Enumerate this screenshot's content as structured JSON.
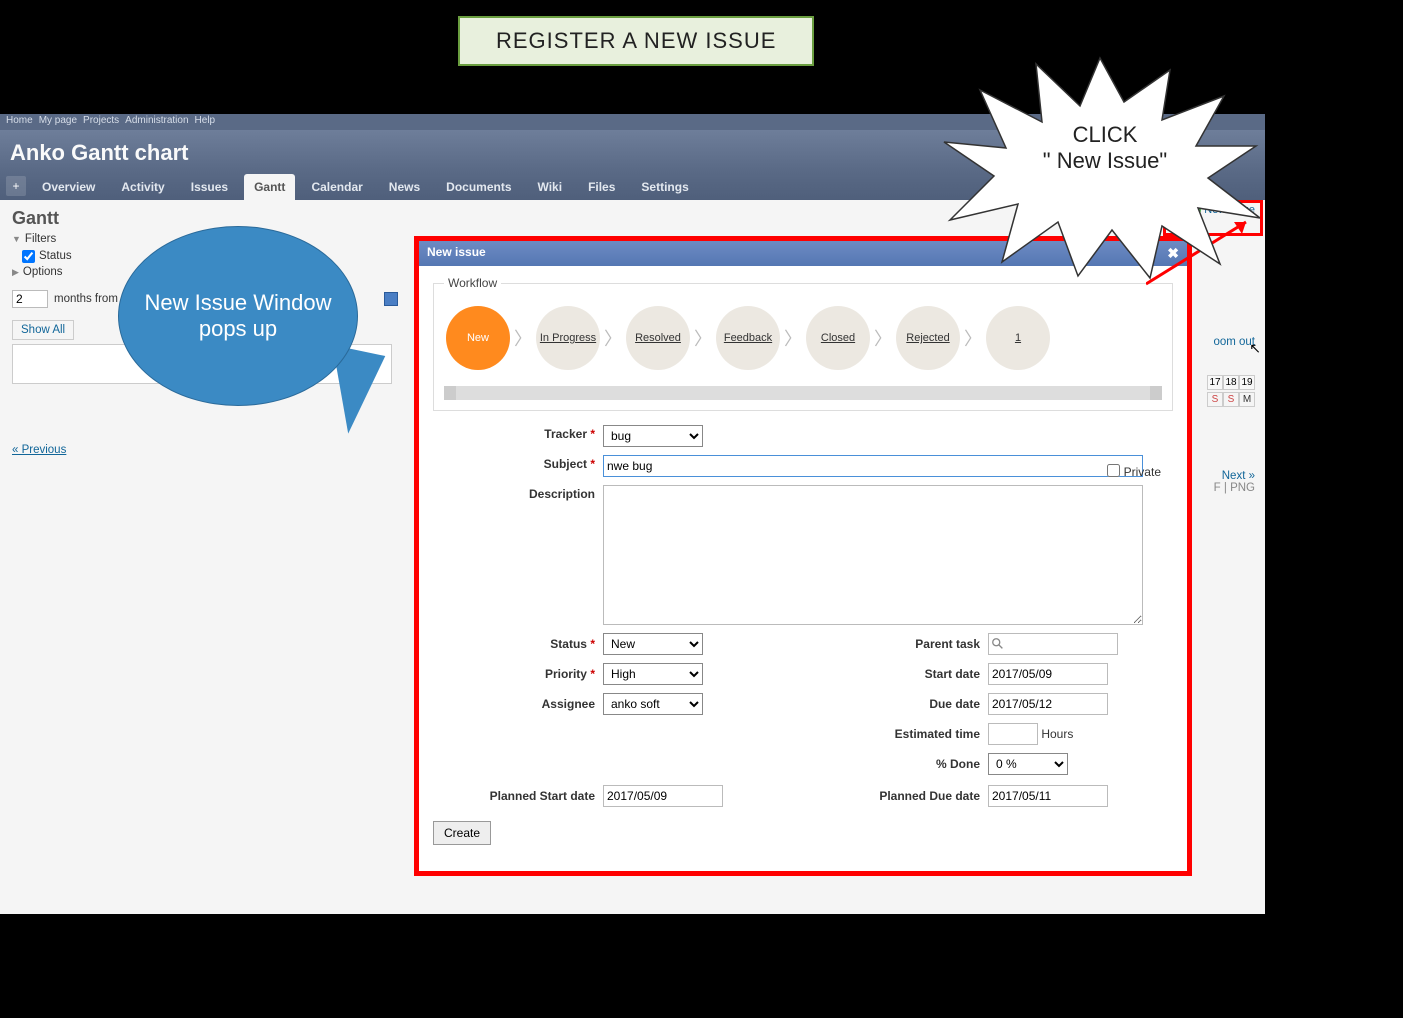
{
  "banner": "REGISTER A NEW ISSUE",
  "topnav": [
    "Home",
    "My page",
    "Projects",
    "Administration",
    "Help"
  ],
  "projectTitle": "Anko Gantt chart",
  "tabs": {
    "plus": "+",
    "items": [
      "Overview",
      "Activity",
      "Issues",
      "Gantt",
      "Calendar",
      "News",
      "Documents",
      "Wiki",
      "Files",
      "Settings"
    ],
    "activeIndex": 3
  },
  "page": {
    "title": "Gantt",
    "newissue": "New issue",
    "filtersLabel": "Filters",
    "statusLabel": "Status",
    "optionsLabel": "Options",
    "monthsValue": "2",
    "monthsLabel1": "months from",
    "showAll": "Show All",
    "previous": "« Previous",
    "nextLabel": "Next »",
    "zoom": "oom out",
    "pdfpng": "F | PNG",
    "days": [
      "17",
      "18",
      "19"
    ],
    "dayLetters": [
      "S",
      "S",
      "M"
    ]
  },
  "dialog": {
    "title": "New issue",
    "workflowLegend": "Workflow",
    "steps": [
      "New",
      "In Progress",
      "Resolved",
      "Feedback",
      "Closed",
      "Rejected",
      "1"
    ],
    "labels": {
      "tracker": "Tracker",
      "subject": "Subject",
      "description": "Description",
      "private": "Private",
      "status": "Status",
      "priority": "Priority",
      "assignee": "Assignee",
      "parent": "Parent task",
      "startdate": "Start date",
      "duedate": "Due date",
      "esttime": "Estimated time",
      "hours": "Hours",
      "pdone": "% Done",
      "pstart": "Planned Start date",
      "pdue": "Planned Due date"
    },
    "values": {
      "tracker": "bug",
      "subject": "nwe bug",
      "description": "",
      "status": "New",
      "priority": "High",
      "assignee": "anko soft",
      "parent": "",
      "startdate": "2017/05/09",
      "duedate": "2017/05/12",
      "esttime": "",
      "pdone": "0 %",
      "pstart": "2017/05/09",
      "pdue": "2017/05/11"
    },
    "create": "Create"
  },
  "callouts": {
    "bubble": "New Issue Window pops up",
    "starLine1": "CLICK",
    "starLine2": "\" New Issue\""
  }
}
